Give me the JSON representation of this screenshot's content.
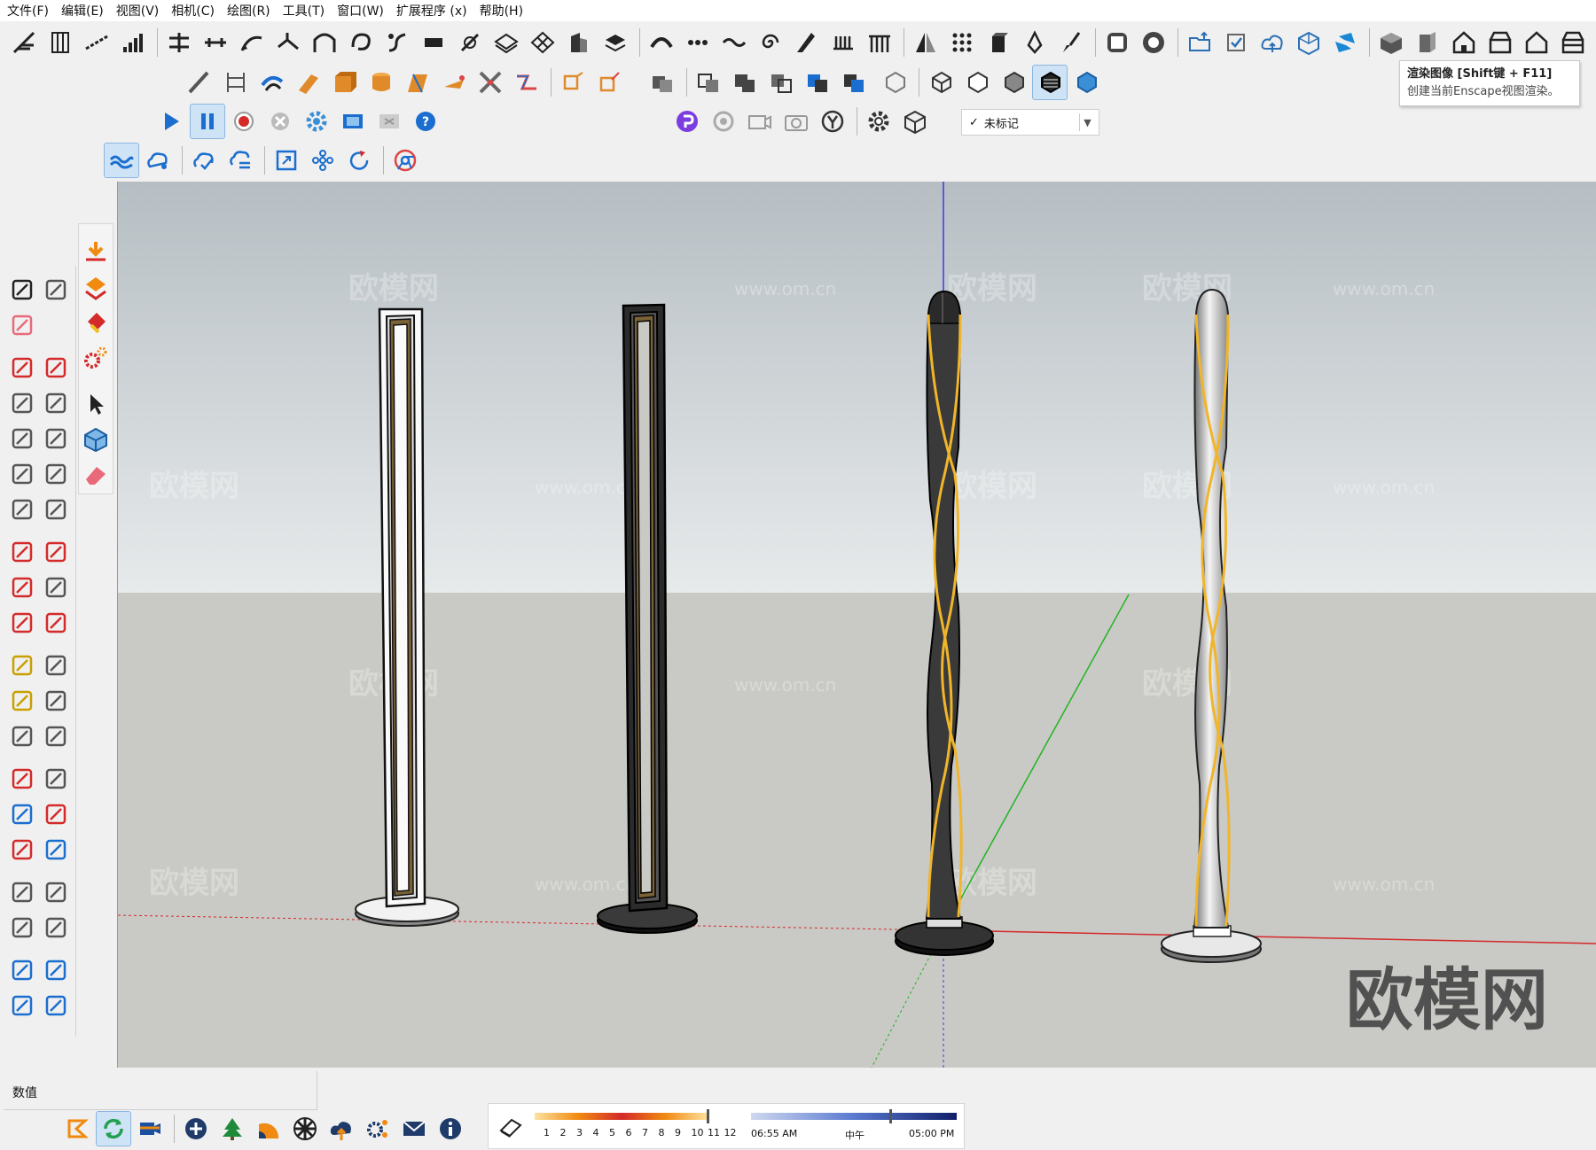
{
  "menu": [
    "文件(F)",
    "编辑(E)",
    "视图(V)",
    "相机(C)",
    "绘图(R)",
    "工具(T)",
    "窗口(W)",
    "扩展程序 (x)",
    "帮助(H)"
  ],
  "tooltip": {
    "title": "渲染图像 [Shift键 + F11]",
    "description": "创建当前Enscape视图渲染。"
  },
  "tag_dropdown": {
    "check": "✓",
    "value": "未标记"
  },
  "measurements": {
    "label": "数值"
  },
  "shadow": {
    "hours": [
      "1",
      "2",
      "3",
      "4",
      "5",
      "6",
      "7",
      "8",
      "9",
      "10",
      "11",
      "12"
    ],
    "start_time": "06:55 AM",
    "noon": "中午",
    "end_time": "05:00 PM"
  },
  "watermark": {
    "logo": "欧模网",
    "url": "www.om.cn"
  },
  "colors": {
    "sky_top": "#b6bec3",
    "sky_bottom": "#e7eaeb",
    "ground": "#c9c9c5",
    "axis_blue": "#3a3adf",
    "axis_green": "#22b422",
    "axis_red": "#d42a2a",
    "gold": "#f0b52a"
  },
  "model": {
    "objects": [
      "floor-lamp-white-frame",
      "floor-lamp-black-frame",
      "floor-lamp-twisted-black",
      "floor-lamp-twisted-white"
    ]
  }
}
